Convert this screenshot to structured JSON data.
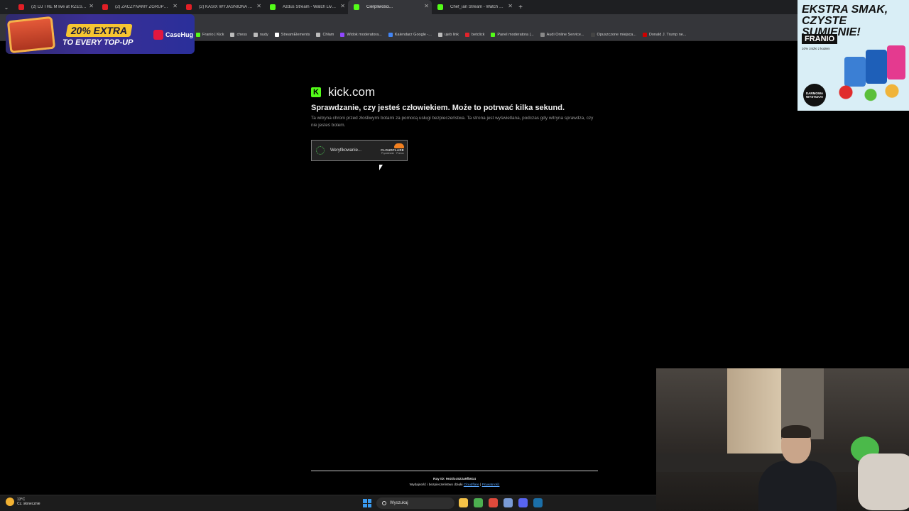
{
  "browser": {
    "tabs": [
      {
        "title": "(2) DJ THE M live at RZESZOW",
        "favicon": "youtube-icon",
        "active": false
      },
      {
        "title": "(2) ZACZYNAMY ZGRUPOWANIE",
        "favicon": "youtube-icon",
        "active": false
      },
      {
        "title": "(2) KASIX WYJAŚNIONA PRZEZ",
        "favicon": "youtube-icon",
        "active": false
      },
      {
        "title": "Azdus Stream - Watch Live on",
        "favicon": "kick-icon",
        "active": false
      },
      {
        "title": "Cierpliwości...",
        "favicon": "kick-icon",
        "active": true
      },
      {
        "title": "Chef_ian Stream - Watch Live o",
        "favicon": "kick-icon",
        "active": false
      }
    ],
    "bookmarks": [
      {
        "label": "Franio | Kick",
        "icon": "kick-icon",
        "color": "#53fc18"
      },
      {
        "label": "chess",
        "icon": "globe-icon",
        "color": "#bbbbbb"
      },
      {
        "label": "nudy",
        "icon": "folder-icon",
        "color": "#bbbbbb"
      },
      {
        "label": "StreamElements",
        "icon": "streamelements-icon",
        "color": "#ffffff"
      },
      {
        "label": "Chłam",
        "icon": "globe-icon",
        "color": "#bbbbbb"
      },
      {
        "label": "Widok moderatora...",
        "icon": "twitch-icon",
        "color": "#9147ff"
      },
      {
        "label": "Kalendarz Google -...",
        "icon": "calendar-icon",
        "color": "#4285f4"
      },
      {
        "label": "ujeb link",
        "icon": "globe-icon",
        "color": "#bbbbbb"
      },
      {
        "label": "betclick",
        "icon": "betclic-icon",
        "color": "#e2232b"
      },
      {
        "label": "Panel moderatora |...",
        "icon": "kick-icon",
        "color": "#53fc18"
      },
      {
        "label": "Audi Online Service...",
        "icon": "audi-icon",
        "color": "#888888"
      },
      {
        "label": "Opuszczone miejsca...",
        "icon": "dark-icon",
        "color": "#444444"
      },
      {
        "label": "Donald J. Trump ne...",
        "icon": "cnn-icon",
        "color": "#cc0000"
      }
    ]
  },
  "ads": {
    "casehug": {
      "percent": "20% EXTRA",
      "subtitle": "TO EVERY TOP-UP",
      "brand": "CaseHug"
    },
    "franio": {
      "headline": "EKSTRA SMAK, CZYSTE SUMIENIE!",
      "brand": "FRANIO",
      "small": "10% zniżki z kodem",
      "badge": "DARMOWA WYSYŁKA!"
    }
  },
  "challenge": {
    "site": "kick.com",
    "title": "Sprawdzanie, czy jesteś człowiekiem. Może to potrwać kilka sekund.",
    "description": "Ta witryna chroni przed złośliwymi botami za pomocą usługi bezpieczeństwa. Ta strona jest wyświetlana, podczas gdy witryna sprawdza, czy nie jesteś botem.",
    "verify_label": "Weryfikowanie...",
    "cf_brand": "CLOUDFLARE",
    "cf_links": "Prywatność · Pomoc",
    "ray_id": "Ray ID: 9e2dcc522a9fb614",
    "perf_text": "Wydajność i bezpieczeństwo dzięki",
    "perf_link": "Cloudflare",
    "privacy_link": "Prywatność"
  },
  "taskbar": {
    "temp": "13°C",
    "weather": "Cz. słonecznie",
    "search_placeholder": "Wyszukaj",
    "apps": [
      {
        "name": "file-explorer-icon",
        "color": "#f4c247"
      },
      {
        "name": "chrome-icon",
        "color": "#4caf50"
      },
      {
        "name": "streamlabs-icon",
        "color": "#e04a3c"
      },
      {
        "name": "settings-icon",
        "color": "#7a9bd6"
      },
      {
        "name": "discord-icon",
        "color": "#5865f2"
      },
      {
        "name": "steam-icon",
        "color": "#1b6fa8"
      }
    ]
  }
}
